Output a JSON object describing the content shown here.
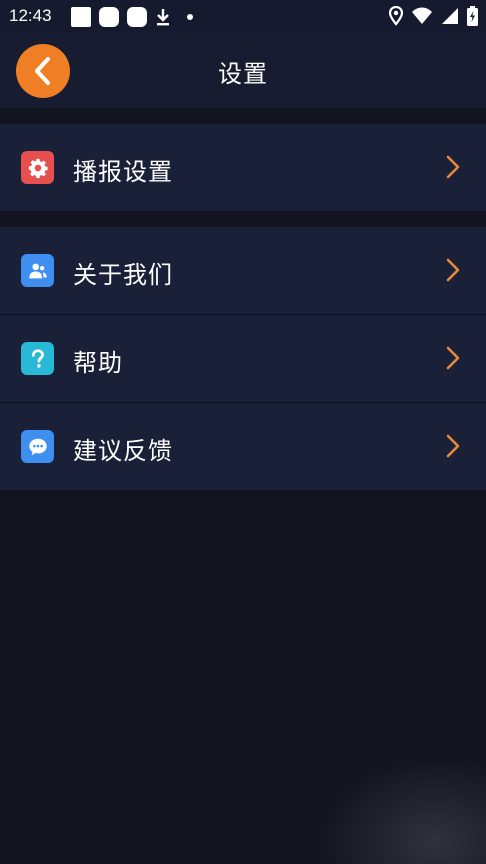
{
  "status_bar": {
    "time": "12:43"
  },
  "header": {
    "title": "设置"
  },
  "menu": {
    "items": [
      {
        "label": "播报设置",
        "icon": "gear-icon",
        "icon_color": "#e6504f"
      },
      {
        "label": "关于我们",
        "icon": "users-icon",
        "icon_color": "#3f8ff0"
      },
      {
        "label": "帮助",
        "icon": "question-icon",
        "icon_color": "#28b9d6"
      },
      {
        "label": "建议反馈",
        "icon": "chat-bubble-icon",
        "icon_color": "#3f8ff0"
      }
    ]
  },
  "colors": {
    "accent": "#ef7e25",
    "chevron": "#e8893c",
    "background": "#121420",
    "row_background": "#1a2038"
  }
}
